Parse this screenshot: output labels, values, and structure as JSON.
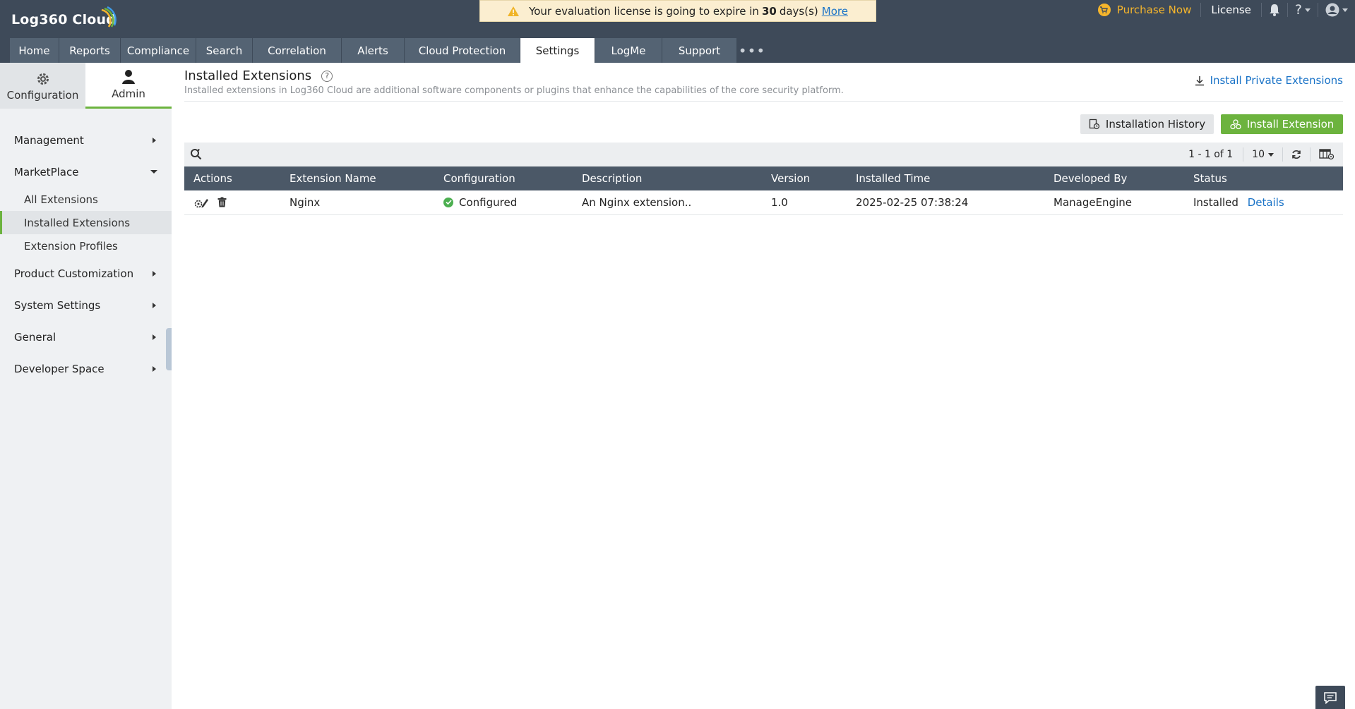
{
  "app": {
    "logo_text": "Log360 Cloud"
  },
  "banner": {
    "text_before": "Your evaluation license is going to expire in",
    "days": "30",
    "text_after": "days(s)",
    "link": "More"
  },
  "top_right": {
    "purchase": "Purchase Now",
    "license": "License",
    "help": "?"
  },
  "tabs": [
    {
      "label": "Home"
    },
    {
      "label": "Reports"
    },
    {
      "label": "Compliance"
    },
    {
      "label": "Search"
    },
    {
      "label": "Correlation"
    },
    {
      "label": "Alerts"
    },
    {
      "label": "Cloud Protection"
    },
    {
      "label": "Settings"
    },
    {
      "label": "LogMe"
    },
    {
      "label": "Support"
    }
  ],
  "tab_more": "•••",
  "active_tab": "Settings",
  "sidebar": {
    "toggle": {
      "configuration": "Configuration",
      "admin": "Admin"
    },
    "sections": {
      "management": "Management",
      "marketplace": "MarketPlace",
      "marketplace_items": [
        "All Extensions",
        "Installed Extensions",
        "Extension Profiles"
      ],
      "product_customization": "Product Customization",
      "system_settings": "System Settings",
      "general": "General",
      "developer_space": "Developer Space"
    }
  },
  "page": {
    "title": "Installed Extensions",
    "subtitle": "Installed extensions in Log360 Cloud are additional software components or plugins that enhance the capabilities of the core security platform.",
    "install_private": "Install Private Extensions",
    "history_button": "Installation History",
    "install_button": "Install Extension"
  },
  "toolbar": {
    "pager": "1 - 1 of 1",
    "per_page": "10"
  },
  "table": {
    "columns": [
      "Actions",
      "Extension Name",
      "Configuration",
      "Description",
      "Version",
      "Installed Time",
      "Developed By",
      "Status"
    ],
    "rows": [
      {
        "name": "Nginx",
        "configuration": "Configured",
        "description": "An Nginx extension..",
        "version": "1.0",
        "installed_time": "2025-02-25 07:38:24",
        "developed_by": "ManageEngine",
        "status": "Installed",
        "details": "Details"
      }
    ]
  },
  "colors": {
    "header_bg": "#3e4a59",
    "tab_bg": "#546373",
    "accent_green": "#6cb33e",
    "link_blue": "#1a73c7",
    "purchase_yellow": "#f5b52c"
  }
}
